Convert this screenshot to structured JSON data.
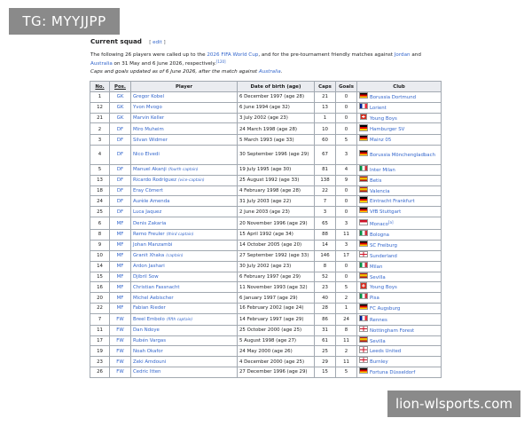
{
  "watermarks": {
    "top": "TG: MYYJJPP",
    "bottom": "lion-wlsports.com"
  },
  "section": {
    "title": "Current squad",
    "edit_open": "[",
    "edit_label": "edit",
    "edit_close": "]"
  },
  "intro": {
    "part1": "The following 26 players were called up to the ",
    "link1": "2026 FIFA World Cup",
    "part2": ", and for the pre-tournament friendly matches against ",
    "link2": "Jordan",
    "part3": " and ",
    "link3": "Australia",
    "part4": " on 31 May and 6 June 2026, respectively.",
    "ref": "[120]",
    "caps_note": "Caps and goals updated as of 6 June 2026, after the match against ",
    "caps_link": "Australia",
    "caps_end": "."
  },
  "table": {
    "headers": {
      "no": "No.",
      "pos": "Pos.",
      "player": "Player",
      "dob": "Date of birth (age)",
      "caps": "Caps",
      "goals": "Goals",
      "club": "Club"
    },
    "rows": [
      {
        "no": "1",
        "pos": "GK",
        "player": "Gregor Kobel",
        "tag": "",
        "dob": "6 December 1997 (age 28)",
        "caps": "21",
        "goals": "0",
        "flag": "germany",
        "club": "Borussia Dortmund",
        "ref": ""
      },
      {
        "no": "12",
        "pos": "GK",
        "player": "Yvon Mvogo",
        "tag": "",
        "dob": "6 June 1994 (age 32)",
        "caps": "13",
        "goals": "0",
        "flag": "france",
        "club": "Lorient",
        "ref": ""
      },
      {
        "no": "21",
        "pos": "GK",
        "player": "Marvin Keller",
        "tag": "",
        "dob": "3 July 2002 (age 23)",
        "caps": "1",
        "goals": "0",
        "flag": "switzerland",
        "club": "Young Boys",
        "ref": ""
      },
      {
        "no": "2",
        "pos": "DF",
        "player": "Miro Muheim",
        "tag": "",
        "dob": "24 March 1998 (age 28)",
        "caps": "10",
        "goals": "0",
        "flag": "germany",
        "club": "Hamburger SV",
        "ref": ""
      },
      {
        "no": "3",
        "pos": "DF",
        "player": "Silvan Widmer",
        "tag": "",
        "dob": "5 March 1993 (age 33)",
        "caps": "60",
        "goals": "5",
        "flag": "germany",
        "club": "Mainz 05",
        "ref": ""
      },
      {
        "no": "4",
        "pos": "DF",
        "player": "Nico Elvedi",
        "tag": "",
        "dob": "30 September 1996 (age 29)",
        "caps": "67",
        "goals": "3",
        "flag": "germany",
        "club": "Borussia Mönchengladbach",
        "ref": ""
      },
      {
        "no": "5",
        "pos": "DF",
        "player": "Manuel Akanji",
        "tag": "(fourth captain)",
        "dob": "19 July 1995 (age 30)",
        "caps": "81",
        "goals": "4",
        "flag": "italy",
        "club": "Inter Milan",
        "ref": ""
      },
      {
        "no": "13",
        "pos": "DF",
        "player": "Ricardo Rodríguez",
        "tag": "(vice-captain)",
        "dob": "25 August 1992 (age 33)",
        "caps": "138",
        "goals": "9",
        "flag": "spain",
        "club": "Betis",
        "ref": ""
      },
      {
        "no": "18",
        "pos": "DF",
        "player": "Eray Cömert",
        "tag": "",
        "dob": "4 February 1998 (age 28)",
        "caps": "22",
        "goals": "0",
        "flag": "spain",
        "club": "Valencia",
        "ref": ""
      },
      {
        "no": "24",
        "pos": "DF",
        "player": "Aurèle Amenda",
        "tag": "",
        "dob": "31 July 2003 (age 22)",
        "caps": "7",
        "goals": "0",
        "flag": "germany",
        "club": "Eintracht Frankfurt",
        "ref": ""
      },
      {
        "no": "25",
        "pos": "DF",
        "player": "Luca Jaquez",
        "tag": "",
        "dob": "2 June 2003 (age 23)",
        "caps": "3",
        "goals": "0",
        "flag": "germany",
        "club": "VfB Stuttgart",
        "ref": ""
      },
      {
        "no": "6",
        "pos": "MF",
        "player": "Denis Zakaria",
        "tag": "",
        "dob": "20 November 1996 (age 29)",
        "caps": "65",
        "goals": "3",
        "flag": "monaco",
        "club": "Monaco",
        "ref": "[a]"
      },
      {
        "no": "8",
        "pos": "MF",
        "player": "Remo Freuler",
        "tag": "(third captain)",
        "dob": "15 April 1992 (age 34)",
        "caps": "88",
        "goals": "11",
        "flag": "italy",
        "club": "Bologna",
        "ref": ""
      },
      {
        "no": "9",
        "pos": "MF",
        "player": "Johan Manzambi",
        "tag": "",
        "dob": "14 October 2005 (age 20)",
        "caps": "14",
        "goals": "3",
        "flag": "germany",
        "club": "SC Freiburg",
        "ref": ""
      },
      {
        "no": "10",
        "pos": "MF",
        "player": "Granit Xhaka",
        "tag": "(captain)",
        "dob": "27 September 1992 (age 33)",
        "caps": "146",
        "goals": "17",
        "flag": "england",
        "club": "Sunderland",
        "ref": ""
      },
      {
        "no": "14",
        "pos": "MF",
        "player": "Ardon Jashari",
        "tag": "",
        "dob": "30 July 2002 (age 23)",
        "caps": "8",
        "goals": "0",
        "flag": "italy",
        "club": "Milan",
        "ref": ""
      },
      {
        "no": "15",
        "pos": "MF",
        "player": "Djibril Sow",
        "tag": "",
        "dob": "6 February 1997 (age 29)",
        "caps": "52",
        "goals": "0",
        "flag": "spain",
        "club": "Sevilla",
        "ref": ""
      },
      {
        "no": "16",
        "pos": "MF",
        "player": "Christian Fassnacht",
        "tag": "",
        "dob": "11 November 1993 (age 32)",
        "caps": "23",
        "goals": "5",
        "flag": "switzerland",
        "club": "Young Boys",
        "ref": ""
      },
      {
        "no": "20",
        "pos": "MF",
        "player": "Michel Aebischer",
        "tag": "",
        "dob": "6 January 1997 (age 29)",
        "caps": "40",
        "goals": "2",
        "flag": "italy",
        "club": "Pisa",
        "ref": ""
      },
      {
        "no": "22",
        "pos": "MF",
        "player": "Fabian Rieder",
        "tag": "",
        "dob": "16 February 2002 (age 24)",
        "caps": "28",
        "goals": "1",
        "flag": "germany",
        "club": "FC Augsburg",
        "ref": ""
      },
      {
        "no": "7",
        "pos": "FW",
        "player": "Breel Embolo",
        "tag": "(fifth captain)",
        "dob": "14 February 1997 (age 29)",
        "caps": "86",
        "goals": "24",
        "flag": "france",
        "club": "Rennes",
        "ref": ""
      },
      {
        "no": "11",
        "pos": "FW",
        "player": "Dan Ndoye",
        "tag": "",
        "dob": "25 October 2000 (age 25)",
        "caps": "31",
        "goals": "8",
        "flag": "england",
        "club": "Nottingham Forest",
        "ref": ""
      },
      {
        "no": "17",
        "pos": "FW",
        "player": "Rubén Vargas",
        "tag": "",
        "dob": "5 August 1998 (age 27)",
        "caps": "61",
        "goals": "11",
        "flag": "spain",
        "club": "Sevilla",
        "ref": ""
      },
      {
        "no": "19",
        "pos": "FW",
        "player": "Noah Okafor",
        "tag": "",
        "dob": "24 May 2000 (age 26)",
        "caps": "25",
        "goals": "2",
        "flag": "england",
        "club": "Leeds United",
        "ref": ""
      },
      {
        "no": "23",
        "pos": "FW",
        "player": "Zeki Amdouni",
        "tag": "",
        "dob": "4 December 2000 (age 25)",
        "caps": "29",
        "goals": "11",
        "flag": "england",
        "club": "Burnley",
        "ref": ""
      },
      {
        "no": "26",
        "pos": "FW",
        "player": "Cedric Itten",
        "tag": "",
        "dob": "27 December 1996 (age 29)",
        "caps": "15",
        "goals": "5",
        "flag": "germany",
        "club": "Fortuna Düsseldorf",
        "ref": ""
      }
    ]
  },
  "colors": {
    "link": "#3366cc",
    "header_bg": "#eaecf0",
    "border": "#a2a9b1"
  }
}
